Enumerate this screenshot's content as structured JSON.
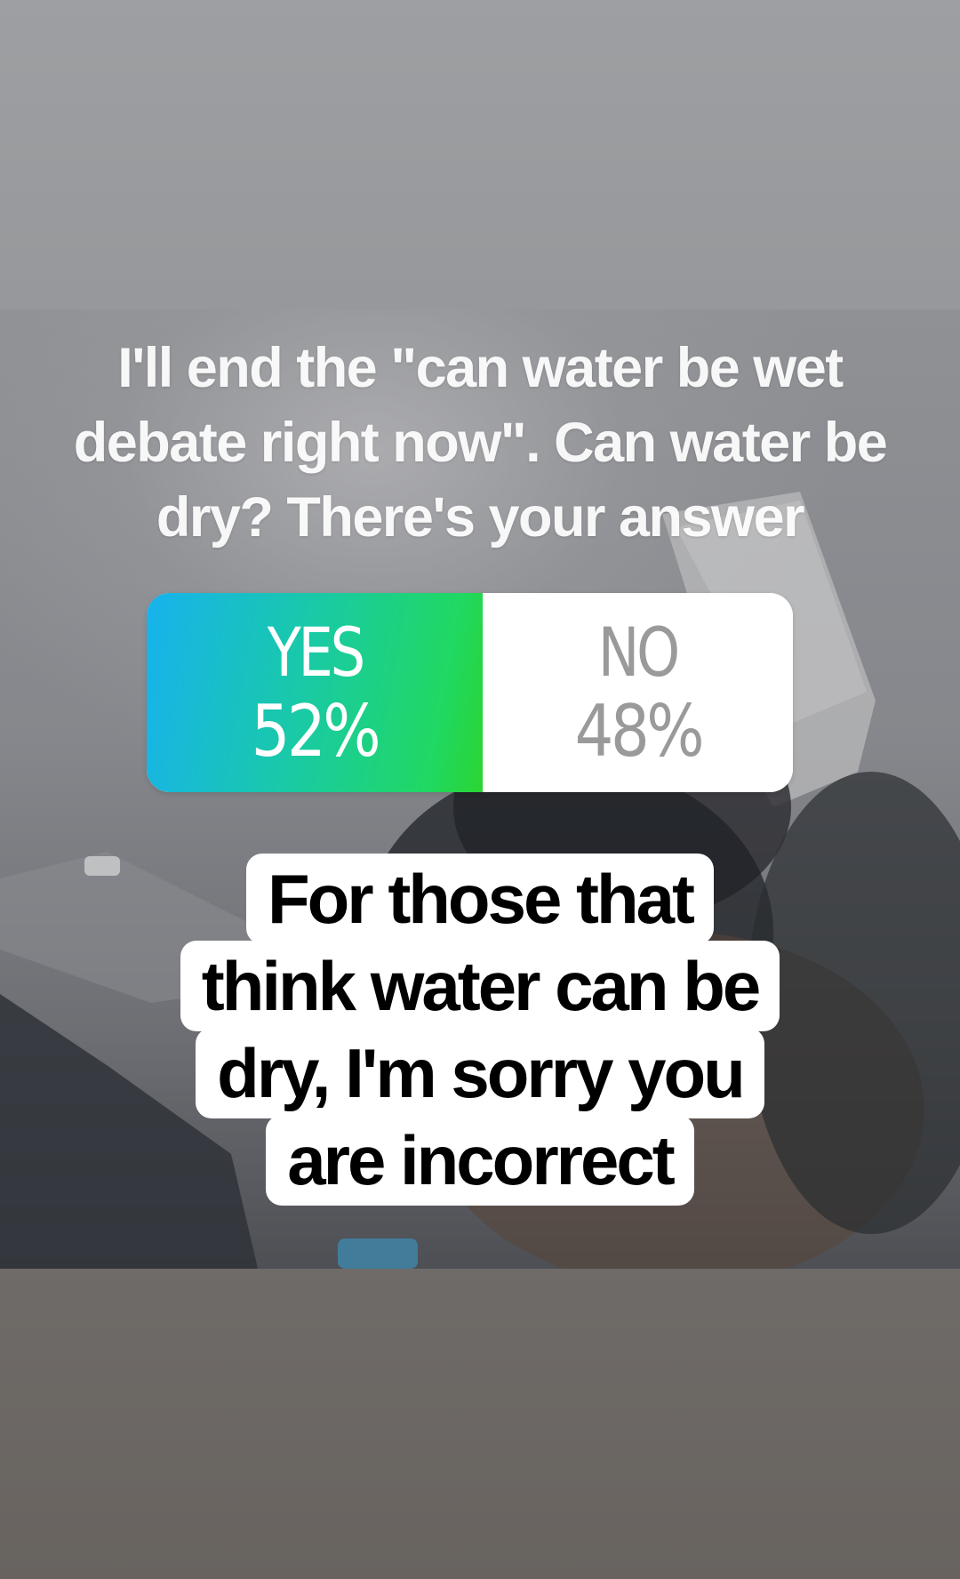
{
  "story": {
    "headline_lines": [
      "I'll end the \"can water be wet",
      "debate right now\". Can water be",
      "dry? There's your answer"
    ],
    "poll": {
      "yes_label": "YES",
      "yes_percent": "52%",
      "no_label": "NO",
      "no_percent": "48%",
      "yes_share": 0.52,
      "yes_gradient": [
        "#17b2ee",
        "#20d862"
      ],
      "no_color": "#ffffff"
    },
    "caption_lines": [
      "For those that",
      "think water can be",
      "dry, I'm sorry you",
      "are incorrect"
    ]
  }
}
